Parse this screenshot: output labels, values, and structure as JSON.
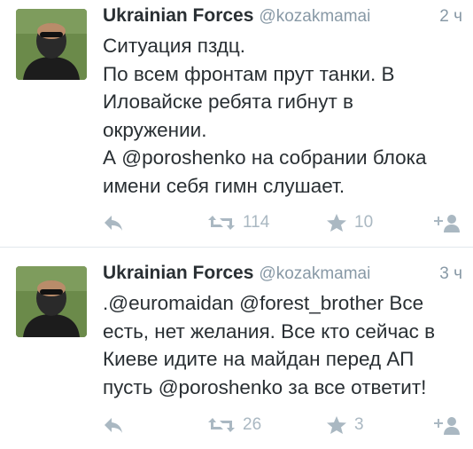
{
  "tweets": [
    {
      "display_name": "Ukrainian Forces",
      "handle": "@kozakmamai",
      "time": "2 ч",
      "lines": [
        "Ситуация пздц.",
        "По всем фронтам прут танки. В",
        "Иловайске ребята гибнут в",
        "окружении.",
        "А @poroshenko на собрании блока",
        "имени себя гимн слушает."
      ],
      "retweets": "114",
      "favorites": "10"
    },
    {
      "display_name": "Ukrainian Forces",
      "handle": "@kozakmamai",
      "time": "3 ч",
      "lines": [
        ".@euromaidan @forest_brother Все",
        "есть, нет желания. Все кто сейчас в",
        "Киеве идите на майдан перед АП",
        "пусть @poroshenko за все ответит!"
      ],
      "retweets": "26",
      "favorites": "3"
    }
  ],
  "colors": {
    "name": "#292f33",
    "meta": "#8899a6",
    "action": "#aab8c2",
    "divider": "#e1e8ed"
  },
  "icons": [
    "avatar-photo",
    "reply-icon",
    "retweet-icon",
    "favorite-star-icon",
    "follow-icon"
  ]
}
